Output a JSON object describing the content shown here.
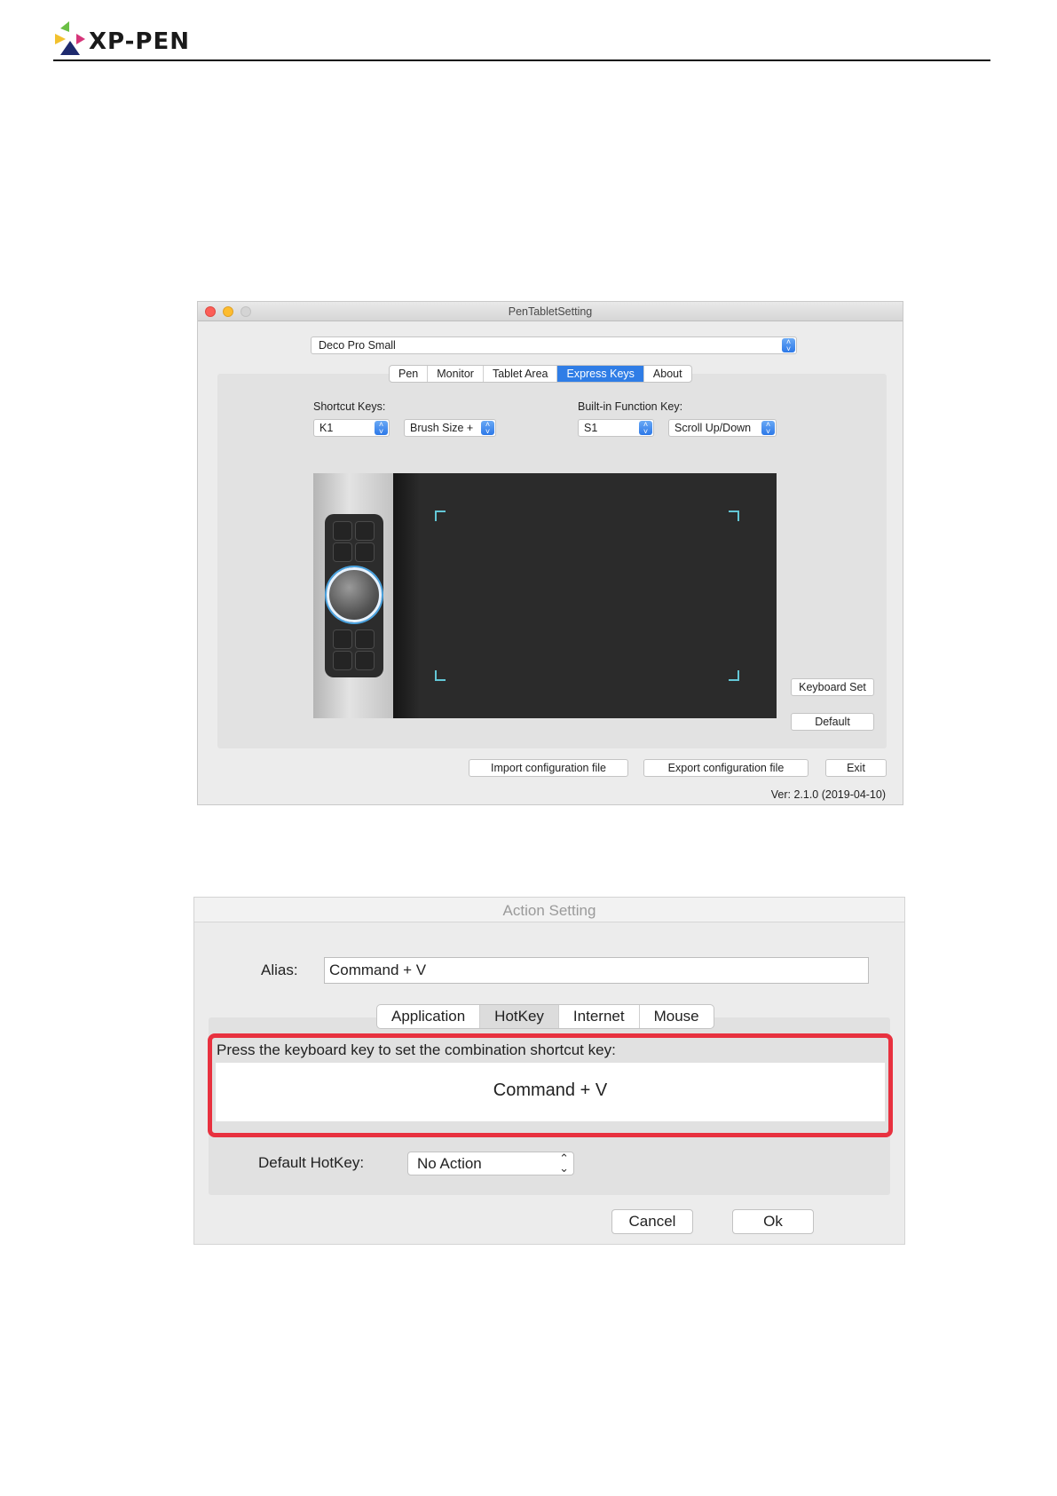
{
  "header": {
    "logo_text": "XP-PEN"
  },
  "window1": {
    "title": "PenTabletSetting",
    "device": "Deco Pro Small",
    "tabs": [
      {
        "label": "Pen",
        "active": false
      },
      {
        "label": "Monitor",
        "active": false
      },
      {
        "label": "Tablet Area",
        "active": false
      },
      {
        "label": "Express Keys",
        "active": true
      },
      {
        "label": "About",
        "active": false
      }
    ],
    "shortcut_keys_label": "Shortcut Keys:",
    "shortcut_key_value": "K1",
    "shortcut_action_value": "Brush Size +",
    "builtin_label": "Built-in Function Key:",
    "builtin_key_value": "S1",
    "builtin_action_value": "Scroll Up/Down",
    "keyboard_set_label": "Keyboard Set",
    "default_label": "Default",
    "import_label": "Import configuration file",
    "export_label": "Export configuration file",
    "exit_label": "Exit",
    "version": "Ver: 2.1.0 (2019-04-10)",
    "accent_color": "#2f7de6"
  },
  "window2": {
    "title": "Action Setting",
    "alias_label": "Alias:",
    "alias_value": "Command + V",
    "tabs": [
      {
        "label": "Application",
        "active": false
      },
      {
        "label": "HotKey",
        "active": true
      },
      {
        "label": "Internet",
        "active": false
      },
      {
        "label": "Mouse",
        "active": false
      }
    ],
    "hint": "Press the keyboard key to set the combination shortcut key:",
    "hotkey_value": "Command + V",
    "default_hotkey_label": "Default HotKey:",
    "default_hotkey_value": "No Action",
    "cancel_label": "Cancel",
    "ok_label": "Ok",
    "highlight_color": "#e8313f"
  }
}
